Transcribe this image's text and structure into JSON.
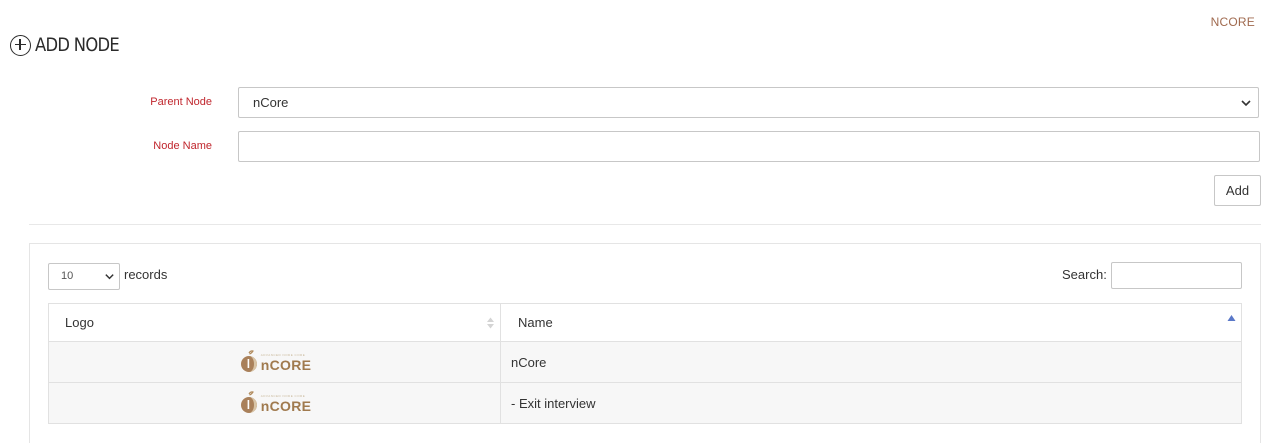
{
  "header": {
    "brand": "NCORE",
    "title": "ADD NODE"
  },
  "form": {
    "parent_node_label": "Parent Node",
    "parent_node_value": "nCore",
    "node_name_label": "Node Name",
    "node_name_value": "",
    "add_label": "Add"
  },
  "table_controls": {
    "page_length": "10",
    "records_label": "records",
    "search_label": "Search:",
    "search_value": ""
  },
  "table": {
    "columns": [
      "Logo",
      "Name"
    ],
    "sorted_column": "Name",
    "sort_direction": "asc",
    "rows": [
      {
        "logo_text": "nCORE",
        "logo_tagline": "ADVANCED NODE CORE",
        "name": "nCore"
      },
      {
        "logo_text": "nCORE",
        "logo_tagline": "ADVANCED NODE CORE",
        "name": "-  Exit interview"
      }
    ]
  },
  "colors": {
    "brand": "#a06a4f",
    "required_label": "#c0262d",
    "sort_active": "#5a78c8",
    "logo_gold": "#a07a4e"
  }
}
